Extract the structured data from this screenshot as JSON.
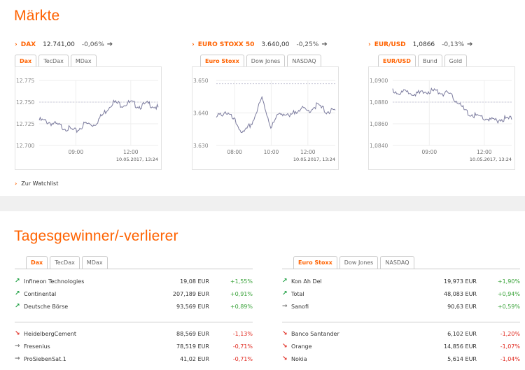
{
  "sections": {
    "markets_title": "Märkte",
    "movers_title": "Tagesgewinner/-verlierer",
    "watchlist_link": "Zur Watchlist"
  },
  "market_panels": [
    {
      "name": "DAX",
      "value": "12.741,00",
      "change": "-0,06%",
      "trend_icon": "arrow-right-icon",
      "tabs": [
        "Dax",
        "TecDax",
        "MDax"
      ],
      "active_tab": 0,
      "timestamp": "10.05.2017, 13:24",
      "y_ticks": [
        "12.775",
        "12.750",
        "12.725",
        "12.700"
      ],
      "x_ticks": [
        "09:00",
        "12:00"
      ]
    },
    {
      "name": "EURO STOXX 50",
      "value": "3.640,00",
      "change": "-0,25%",
      "trend_icon": "arrow-right-icon",
      "tabs": [
        "Euro Stoxx",
        "Dow Jones",
        "NASDAQ"
      ],
      "active_tab": 0,
      "timestamp": "10.05.2017, 13:24",
      "y_ticks": [
        "3.650",
        "3.640",
        "3.630"
      ],
      "x_ticks": [
        "08:00",
        "10:00",
        "12:00"
      ]
    },
    {
      "name": "EUR/USD",
      "value": "1,0866",
      "change": "-0,13%",
      "trend_icon": "arrow-right-icon",
      "tabs": [
        "EUR/USD",
        "Bund",
        "Gold"
      ],
      "active_tab": 0,
      "timestamp": "10.05.2017, 13:24",
      "y_ticks": [
        "1,0900",
        "1,0880",
        "1,0860",
        "1,0840"
      ],
      "x_ticks": [
        "09:00",
        "12:00"
      ]
    }
  ],
  "chart_data": [
    {
      "type": "line",
      "x": [
        "07:00",
        "07:30",
        "08:00",
        "08:30",
        "09:00",
        "09:30",
        "10:00",
        "10:30",
        "11:00",
        "11:30",
        "12:00",
        "12:30",
        "13:00",
        "13:24"
      ],
      "series": [
        {
          "values": [
            12731,
            12729,
            12725,
            12722,
            12718,
            12727,
            12726,
            12738,
            12752,
            12749,
            12751,
            12747,
            12750,
            12745
          ]
        }
      ],
      "ylim": [
        12700,
        12775
      ],
      "y_ticks": [
        12700,
        12725,
        12750,
        12775
      ],
      "reference_line": 12750
    },
    {
      "type": "line",
      "x": [
        "07:00",
        "07:30",
        "08:00",
        "08:30",
        "09:00",
        "09:30",
        "10:00",
        "10:30",
        "11:00",
        "11:30",
        "12:00",
        "12:30",
        "13:00",
        "13:24"
      ],
      "series": [
        {
          "values": [
            3639,
            3641,
            3638,
            3634,
            3638,
            3645,
            3636,
            3641,
            3639,
            3642,
            3641,
            3643,
            3641,
            3641
          ]
        }
      ],
      "ylim": [
        3630,
        3650
      ],
      "y_ticks": [
        3630,
        3640,
        3650
      ],
      "reference_line": 3649
    },
    {
      "type": "line",
      "x": [
        "07:00",
        "07:30",
        "08:00",
        "08:30",
        "09:00",
        "09:30",
        "10:00",
        "10:30",
        "11:00",
        "11:30",
        "12:00",
        "12:30",
        "13:00",
        "13:24"
      ],
      "series": [
        {
          "values": [
            1.0892,
            1.089,
            1.0891,
            1.0889,
            1.0892,
            1.0891,
            1.0889,
            1.0883,
            1.0872,
            1.0869,
            1.0867,
            1.0864,
            1.0866,
            1.0866
          ]
        }
      ],
      "ylim": [
        1.084,
        1.09
      ],
      "y_ticks": [
        1.084,
        1.086,
        1.088,
        1.09
      ],
      "reference_line": 1.088
    }
  ],
  "movers": {
    "left": {
      "tabs": [
        "Dax",
        "TecDax",
        "MDax"
      ],
      "active_tab": 0,
      "gainers": [
        {
          "name": "Infineon Technologies",
          "price": "19,08 EUR",
          "change": "+1,55%",
          "icon": "arrow-up-right-icon"
        },
        {
          "name": "Continental",
          "price": "207,189 EUR",
          "change": "+0,91%",
          "icon": "arrow-up-right-icon"
        },
        {
          "name": "Deutsche Börse",
          "price": "93,569 EUR",
          "change": "+0,89%",
          "icon": "arrow-up-right-icon"
        }
      ],
      "losers": [
        {
          "name": "HeidelbergCement",
          "price": "88,569 EUR",
          "change": "-1,13%",
          "icon": "arrow-down-right-icon"
        },
        {
          "name": "Fresenius",
          "price": "78,519 EUR",
          "change": "-0,71%",
          "icon": "arrow-right-icon"
        },
        {
          "name": "ProSiebenSat.1",
          "price": "41,02 EUR",
          "change": "-0,71%",
          "icon": "arrow-right-icon"
        }
      ]
    },
    "right": {
      "tabs": [
        "Euro Stoxx",
        "Dow Jones",
        "NASDAQ"
      ],
      "active_tab": 0,
      "gainers": [
        {
          "name": "Kon Ah Del",
          "price": "19,973 EUR",
          "change": "+1,90%",
          "icon": "arrow-up-right-icon"
        },
        {
          "name": "Total",
          "price": "48,083 EUR",
          "change": "+0,94%",
          "icon": "arrow-up-right-icon"
        },
        {
          "name": "Sanofi",
          "price": "90,63 EUR",
          "change": "+0,59%",
          "icon": "arrow-right-icon"
        }
      ],
      "losers": [
        {
          "name": "Banco Santander",
          "price": "6,102 EUR",
          "change": "-1,20%",
          "icon": "arrow-down-right-icon"
        },
        {
          "name": "Orange",
          "price": "14,856 EUR",
          "change": "-1,07%",
          "icon": "arrow-down-right-icon"
        },
        {
          "name": "Nokia",
          "price": "5,614 EUR",
          "change": "-1,04%",
          "icon": "arrow-down-right-icon"
        }
      ]
    }
  },
  "colors": {
    "accent": "#ff6200",
    "positive": "#3aa33a",
    "negative": "#e0281e",
    "line": "#7b7b9e"
  }
}
